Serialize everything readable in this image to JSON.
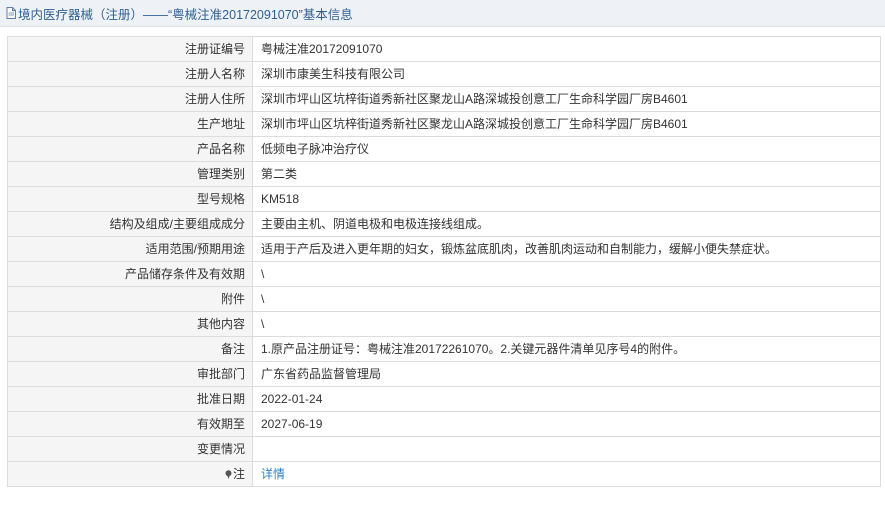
{
  "header": {
    "title": "境内医疗器械（注册）——“粤械注准20172091070”基本信息",
    "icon": "document-icon"
  },
  "rows": [
    {
      "label": "注册证编号",
      "value": "粤械注准20172091070"
    },
    {
      "label": "注册人名称",
      "value": "深圳市康美生科技有限公司"
    },
    {
      "label": "注册人住所",
      "value": "深圳市坪山区坑梓街道秀新社区聚龙山A路深城投创意工厂生命科学园厂房B4601"
    },
    {
      "label": "生产地址",
      "value": "深圳市坪山区坑梓街道秀新社区聚龙山A路深城投创意工厂生命科学园厂房B4601"
    },
    {
      "label": "产品名称",
      "value": "低频电子脉冲治疗仪"
    },
    {
      "label": "管理类别",
      "value": "第二类"
    },
    {
      "label": "型号规格",
      "value": "KM518"
    },
    {
      "label": "结构及组成/主要组成成分",
      "value": "主要由主机、阴道电极和电极连接线组成。"
    },
    {
      "label": "适用范围/预期用途",
      "value": "适用于产后及进入更年期的妇女，锻炼盆底肌肉，改善肌肉运动和自制能力，缓解小便失禁症状。"
    },
    {
      "label": "产品储存条件及有效期",
      "value": "\\"
    },
    {
      "label": "附件",
      "value": "\\"
    },
    {
      "label": "其他内容",
      "value": "\\"
    },
    {
      "label": "备注",
      "value": "1.原产品注册证号：粤械注准20172261070。2.关键元器件清单见序号4的附件。"
    },
    {
      "label": "审批部门",
      "value": "广东省药品监督管理局"
    },
    {
      "label": "批准日期",
      "value": "2022-01-24"
    },
    {
      "label": "有效期至",
      "value": "2027-06-19"
    },
    {
      "label": "变更情况",
      "value": ""
    }
  ],
  "note": {
    "label": "注",
    "link_text": "详情",
    "icon": "pin-icon"
  }
}
